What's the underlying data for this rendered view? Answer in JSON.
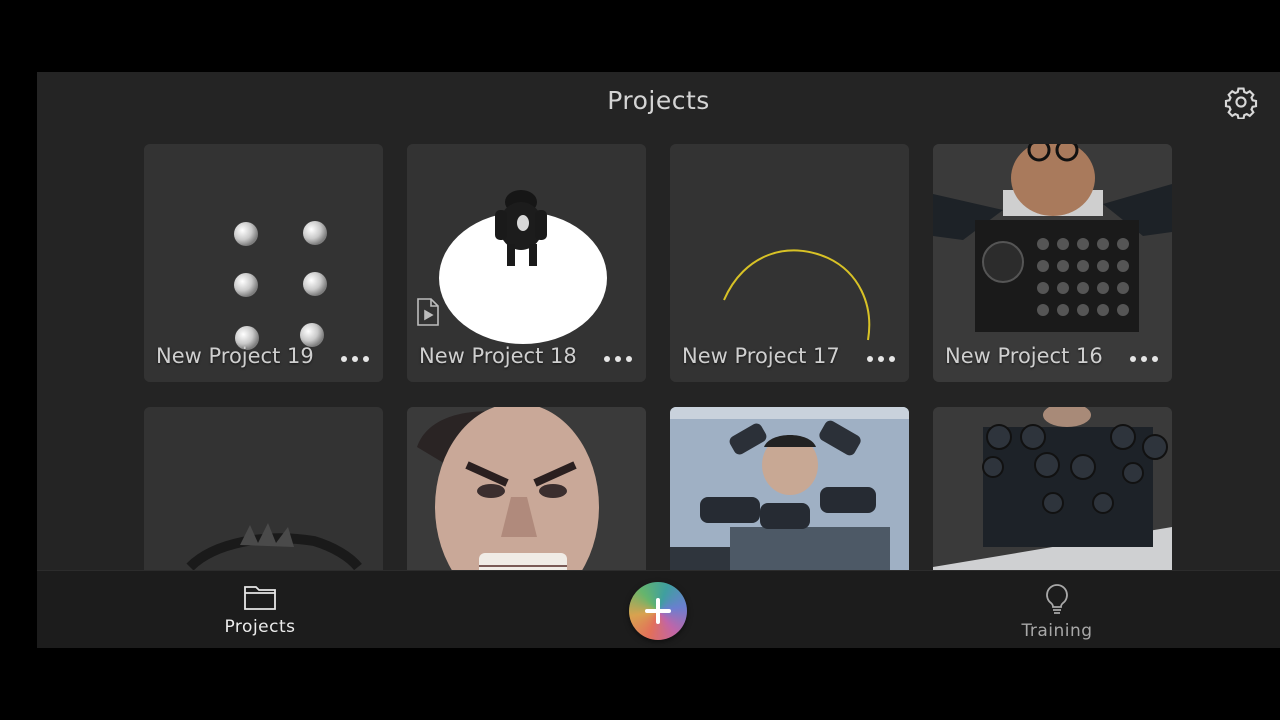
{
  "header": {
    "title": "Projects"
  },
  "projects": [
    {
      "name": "New Project 19",
      "thumb": "spheres"
    },
    {
      "name": "New Project 18",
      "thumb": "figure-on-disc"
    },
    {
      "name": "New Project 17",
      "thumb": "yellow-arc"
    },
    {
      "name": "New Project 16",
      "thumb": "speaker-man"
    },
    {
      "name": "",
      "thumb": "dark-spiky"
    },
    {
      "name": "",
      "thumb": "angry-face"
    },
    {
      "name": "",
      "thumb": "cannon-head"
    },
    {
      "name": "",
      "thumb": "cannon-bust"
    }
  ],
  "bottom_nav": {
    "projects_label": "Projects",
    "training_label": "Training",
    "add_icon": "plus-icon"
  },
  "colors": {
    "background": "#242424",
    "card": "#333333",
    "accent_arc": "#d8c226",
    "bottom_bar": "#1c1c1c"
  }
}
